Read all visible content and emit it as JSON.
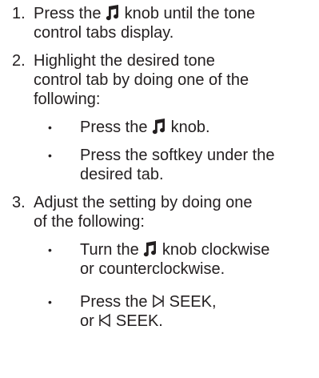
{
  "steps": [
    {
      "number": "1.",
      "line1": {
        "before": "Press the",
        "icon": "music-note-icon",
        "after": "knob until the tone"
      },
      "line2": "control tabs display."
    },
    {
      "number": "2.",
      "line1": "Highlight the desired tone",
      "line2": "control tab by doing one of the",
      "line3": "following:",
      "bullets": [
        {
          "line1": {
            "before": "Press the",
            "icon": "music-note-icon",
            "after": "knob."
          }
        },
        {
          "line1": "Press the softkey under the",
          "line2": "desired tab."
        }
      ]
    },
    {
      "number": "3.",
      "line1": "Adjust the setting by doing one",
      "line2": "of the following:",
      "bullets": [
        {
          "line1": {
            "before": "Turn the",
            "icon": "music-note-icon",
            "after": "knob clockwise"
          },
          "line2": "or counterclockwise."
        },
        {
          "line1": {
            "before": "Press the",
            "icon": "seek-forward-icon",
            "after": "SEEK,"
          },
          "line2": {
            "before": "or",
            "icon": "seek-back-icon",
            "after": "SEEK."
          }
        }
      ]
    }
  ],
  "bullet_char": "•"
}
